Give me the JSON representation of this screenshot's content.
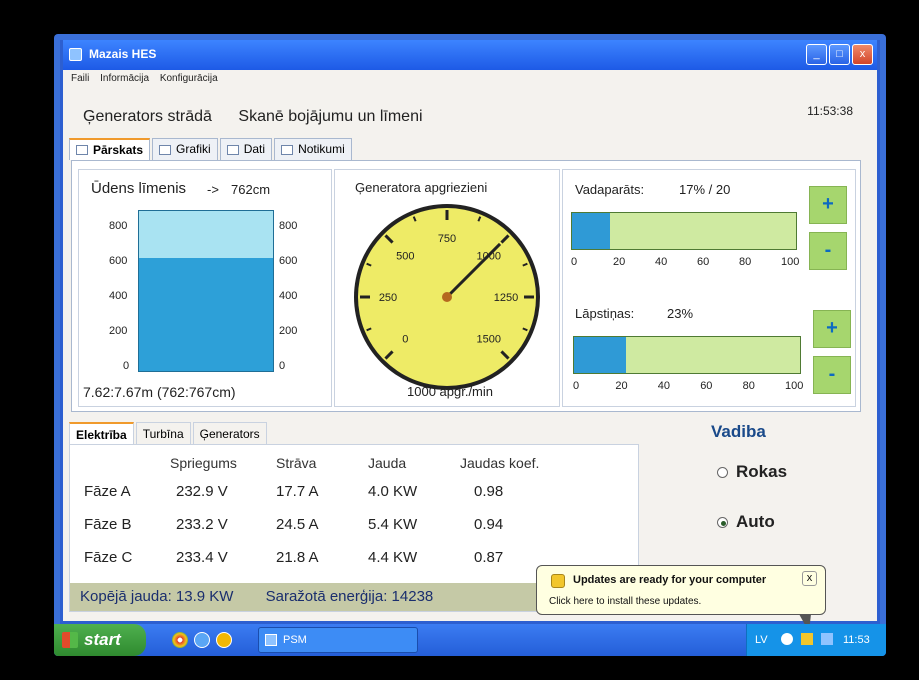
{
  "window": {
    "title": "Mazais HES",
    "min": "_",
    "max": "□",
    "close": "x"
  },
  "menu": [
    "Faili",
    "Informācija",
    "Konfigurācija"
  ],
  "status": {
    "generator": "Ģenerators strādā",
    "scan": "Skanē bojājumu un līmeni",
    "time": "11:53:38"
  },
  "tabs": [
    "Pārskats",
    "Grafiki",
    "Dati",
    "Notikumi"
  ],
  "water": {
    "label": "Ūdens līmenis",
    "arrow": "->",
    "value": "762cm",
    "range_text": "7.62:7.67m (762:767cm)",
    "level_cm": 762,
    "max_cm": 900,
    "ticks": [
      "800",
      "600",
      "400",
      "200",
      "0"
    ]
  },
  "gauge": {
    "label": "Ģeneratora apgriezieni",
    "value_text": "1000 apgr./min",
    "value": 1000,
    "min": 0,
    "max": 1500,
    "tick_labels": [
      "0",
      "250",
      "500",
      "750",
      "1000",
      "1250",
      "1500"
    ]
  },
  "guide": {
    "label": "Vadaparāts:",
    "value_text": "17% / 20",
    "percent": 17,
    "plus": "+",
    "minus": "-"
  },
  "blades": {
    "label": "Lāpstiņas:",
    "value_text": "23%",
    "percent": 23,
    "plus": "+",
    "minus": "-"
  },
  "scale": [
    "0",
    "20",
    "40",
    "60",
    "80",
    "100"
  ],
  "lower_tabs": [
    "Elektrība",
    "Turbīna",
    "Ģenerators"
  ],
  "electric": {
    "headers": [
      "Spriegums",
      "Strāva",
      "Jauda",
      "Jaudas koef."
    ],
    "rows": [
      {
        "phase": "Fāze A",
        "voltage": "232.9 V",
        "current": "17.7 A",
        "power": "4.0 KW",
        "pf": "0.98"
      },
      {
        "phase": "Fāze B",
        "voltage": "233.2 V",
        "current": "24.5 A",
        "power": "5.4 KW",
        "pf": "0.94"
      },
      {
        "phase": "Fāze C",
        "voltage": "233.4 V",
        "current": "21.8 A",
        "power": "4.4 KW",
        "pf": "0.87"
      }
    ],
    "total_label": "Kopējā jauda:",
    "total_value": "13.9 KW",
    "energy_label": "Saražotā enerģija:",
    "energy_value": "14238"
  },
  "control": {
    "title": "Vadiba",
    "manual": "Rokas",
    "auto": "Auto",
    "selected": "auto"
  },
  "balloon": {
    "title": "Updates are ready for your computer",
    "body": "Click here to install these updates.",
    "close": "x"
  },
  "taskbar": {
    "start": "start",
    "task": "PSM",
    "lang": "LV",
    "time": "11:53"
  }
}
